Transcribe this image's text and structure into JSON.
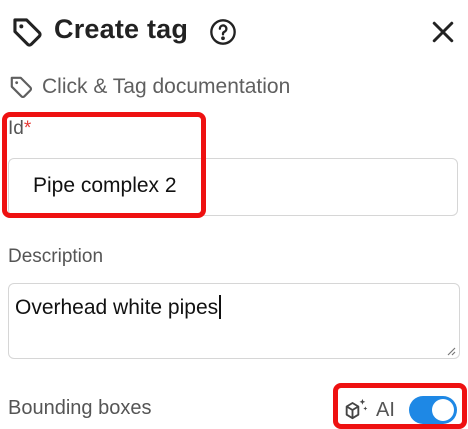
{
  "header": {
    "title": "Create tag",
    "tag_icon": "tag-icon",
    "help_icon": "help-circle-icon",
    "close_icon": "close-icon"
  },
  "doc_link": {
    "icon": "tag-outline-icon",
    "label": "Click & Tag documentation"
  },
  "id_field": {
    "label": "Id",
    "required_marker": "*",
    "value": "Pipe complex 2"
  },
  "description_field": {
    "label": "Description",
    "value": "Overhead white pipes"
  },
  "bounding_boxes": {
    "label": "Bounding boxes",
    "ai_icon": "ai-cube-sparkle-icon",
    "ai_label": "AI",
    "ai_toggle_on": true
  },
  "colors": {
    "highlight": "#ee1111",
    "toggle_on": "#1e88e5",
    "required": "#e53935"
  }
}
